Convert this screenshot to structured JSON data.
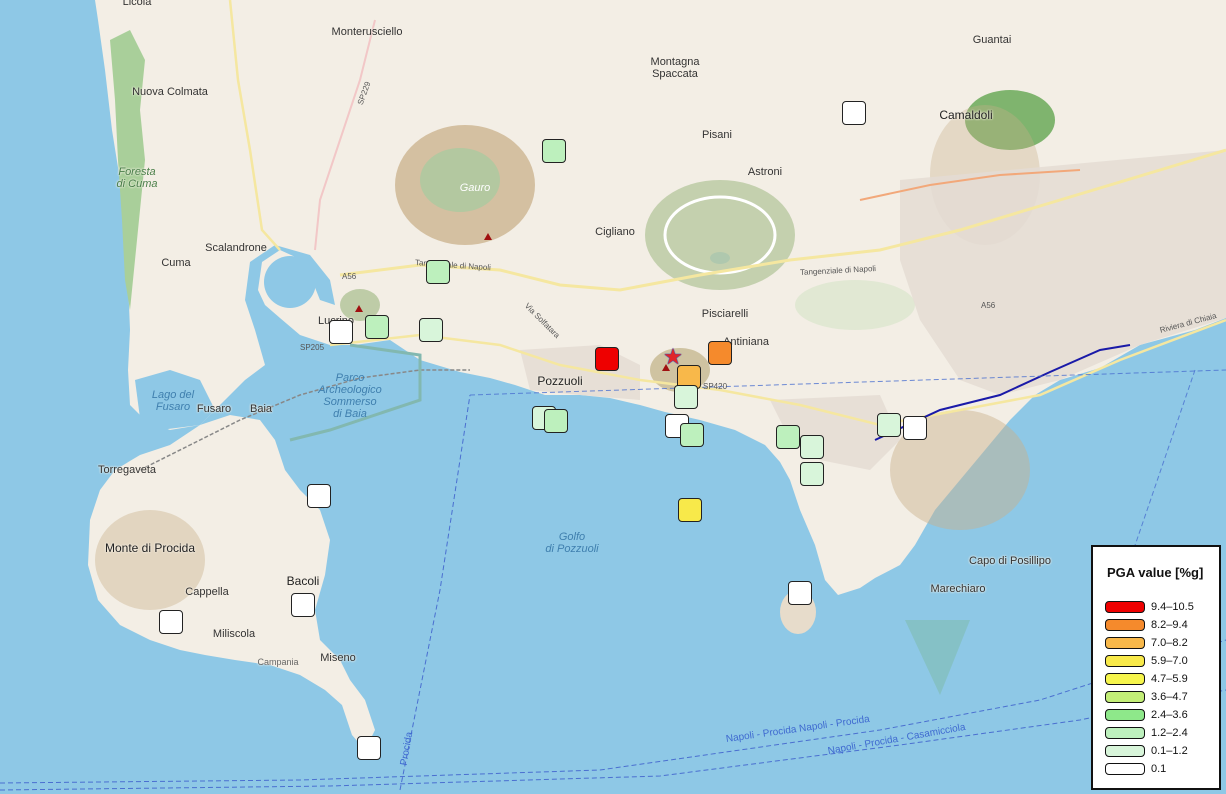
{
  "places": {
    "licola": "Licola",
    "monterusciello": "Monterusciello",
    "nuova_colmata": "Nuova Colmata",
    "montagna_spaccata": "Montagna\nSpaccata",
    "guantai": "Guantai",
    "camaldoli": "Camaldoli",
    "pisani": "Pisani",
    "astroni": "Astroni",
    "foresta_di_cuma": "Foresta\ndi Cuma",
    "gauro": "Gauro",
    "cigliano": "Cigliano",
    "scalandrone": "Scalandrone",
    "cuma": "Cuma",
    "pisciarelli": "Pisciarelli",
    "antiniana": "Antiniana",
    "lucrino": "Lucrino",
    "pozzuoli": "Pozzuoli",
    "parco_archeologico": "Parco\nArcheologico\nSommerso\ndi Baia",
    "lago_del_fusaro": "Lago del\nFusaro",
    "fusaro": "Fusaro",
    "baia": "Baia",
    "torregaveta": "Torregaveta",
    "golfo_di_pozzuoli": "Golfo\ndi Pozzuoli",
    "monte_di_procida": "Monte di Procida",
    "bacoli": "Bacoli",
    "cappella": "Cappella",
    "miliscola": "Miliscola",
    "miseno": "Miseno",
    "capo_di_posillipo": "Capo di Posillipo",
    "marechiaro": "Marechiaro",
    "campania": "Campania"
  },
  "roads": {
    "tangenziale_1": "Tangenziale di Napoli",
    "tangenziale_2": "Tangenziale di Napoli",
    "via_solfatara": "Via Solfatara",
    "sp229": "SP229",
    "sp420": "SP420",
    "a56_1": "A56",
    "a56_2": "A56",
    "riviera_chiaia": "Riviera di Chiaia",
    "sp205": "SP205",
    "ferry_1": "Napoli - Procida  Napoli - Procida",
    "ferry_2": "Napoli - Procida - Casamicciola",
    "ferry_3": "Procida"
  },
  "legend": {
    "title": "PGA value [%g]",
    "items": [
      {
        "label": "9.4–10.5",
        "color": "#ee0000"
      },
      {
        "label": "8.2–9.4",
        "color": "#f58a2c"
      },
      {
        "label": "7.0–8.2",
        "color": "#f8b84a"
      },
      {
        "label": "5.9–7.0",
        "color": "#f8e94a"
      },
      {
        "label": "4.7–5.9",
        "color": "#f6f54c"
      },
      {
        "label": "3.6–4.7",
        "color": "#c3ee77"
      },
      {
        "label": "2.4–3.6",
        "color": "#8ee88a"
      },
      {
        "label": "1.2–2.4",
        "color": "#bdf0bd"
      },
      {
        "label": "0.1–1.2",
        "color": "#d8f5da"
      },
      {
        "label": "0.1",
        "color": "#ffffff"
      }
    ]
  },
  "stations": [
    {
      "class": "1.2–2.4",
      "color": "#bdf0bd"
    },
    {
      "class": "0.1",
      "color": "#ffffff"
    },
    {
      "class": "1.2–2.4",
      "color": "#bdf0bd"
    },
    {
      "class": "0.1",
      "color": "#ffffff"
    },
    {
      "class": "1.2–2.4",
      "color": "#bdf0bd"
    },
    {
      "class": "0.1–1.2",
      "color": "#d8f5da"
    },
    {
      "class": "9.4–10.5",
      "color": "#ee0000"
    },
    {
      "class": "8.2–9.4",
      "color": "#f58a2c"
    },
    {
      "class": "7.0–8.2",
      "color": "#f8b84a"
    },
    {
      "class": "0.1–1.2",
      "color": "#d8f5da"
    },
    {
      "class": "0.1–1.2",
      "color": "#d8f5da"
    },
    {
      "class": "1.2–2.4",
      "color": "#bdf0bd"
    },
    {
      "class": "0.1",
      "color": "#ffffff"
    },
    {
      "class": "1.2–2.4",
      "color": "#bdf0bd"
    },
    {
      "class": "1.2–2.4",
      "color": "#bdf0bd"
    },
    {
      "class": "0.1–1.2",
      "color": "#d8f5da"
    },
    {
      "class": "0.1–1.2",
      "color": "#d8f5da"
    },
    {
      "class": "0.1–1.2",
      "color": "#d8f5da"
    },
    {
      "class": "0.1",
      "color": "#ffffff"
    },
    {
      "class": "0.1",
      "color": "#ffffff"
    },
    {
      "class": "5.9–7.0",
      "color": "#f8e94a"
    },
    {
      "class": "0.1",
      "color": "#ffffff"
    },
    {
      "class": "0.1",
      "color": "#ffffff"
    },
    {
      "class": "0.1",
      "color": "#ffffff"
    },
    {
      "class": "0.1",
      "color": "#ffffff"
    }
  ],
  "epicenter": {
    "symbol": "★",
    "color": "#e0262a"
  }
}
